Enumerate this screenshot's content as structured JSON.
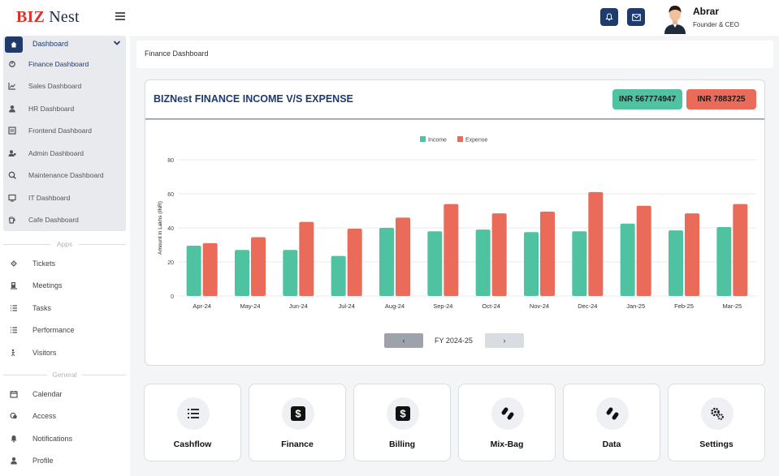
{
  "brand": {
    "part1": "BIZ",
    "part2": "Nest"
  },
  "user": {
    "name": "Abrar",
    "role": "Founder & CEO"
  },
  "sidebar": {
    "dashboard_label": "Dashboard",
    "dashboards": [
      {
        "label": "Finance Dashboard",
        "icon": "finance-icon"
      },
      {
        "label": "Sales Dashboard",
        "icon": "sales-icon"
      },
      {
        "label": "HR Dashboard",
        "icon": "hr-icon"
      },
      {
        "label": "Frontend Dashboard",
        "icon": "frontend-icon"
      },
      {
        "label": "Admin Dashboard",
        "icon": "admin-icon"
      },
      {
        "label": "Maintenance Dashboard",
        "icon": "maintenance-icon"
      },
      {
        "label": "IT Dashboard",
        "icon": "it-icon"
      },
      {
        "label": "Cafe Dashboard",
        "icon": "cafe-icon"
      }
    ],
    "apps_section": "Apps",
    "apps": [
      {
        "label": "Tickets",
        "icon": "ticket-icon"
      },
      {
        "label": "Meetings",
        "icon": "meeting-icon"
      },
      {
        "label": "Tasks",
        "icon": "tasks-icon"
      },
      {
        "label": "Performance",
        "icon": "performance-icon"
      },
      {
        "label": "Visitors",
        "icon": "visitors-icon"
      }
    ],
    "general_section": "General",
    "general": [
      {
        "label": "Calendar",
        "icon": "calendar-icon"
      },
      {
        "label": "Access",
        "icon": "access-icon"
      },
      {
        "label": "Notifications",
        "icon": "bell-icon"
      },
      {
        "label": "Profile",
        "icon": "profile-icon"
      }
    ]
  },
  "breadcrumb": "Finance Dashboard",
  "card": {
    "title": "BIZNest FINANCE INCOME V/S EXPENSE",
    "income_badge": "INR  567774947",
    "expense_badge": "INR  7883725",
    "prev_label": "‹",
    "next_label": "›",
    "period_label": "FY 2024-25"
  },
  "colors": {
    "income": "#4fc3a1",
    "expense": "#ea6b5a",
    "navy": "#1f3b6e"
  },
  "chart_data": {
    "type": "bar",
    "categories": [
      "Apr-24",
      "May-24",
      "Jun-24",
      "Jul-24",
      "Aug-24",
      "Sep-24",
      "Oct-24",
      "Nov-24",
      "Dec-24",
      "Jan-25",
      "Feb-25",
      "Mar-25"
    ],
    "series": [
      {
        "name": "Income",
        "values": [
          29.5,
          27,
          27,
          23.5,
          40,
          38,
          39,
          37.5,
          38,
          42.5,
          38.5,
          40.5
        ]
      },
      {
        "name": "Expense",
        "values": [
          31,
          34.5,
          43.5,
          39.5,
          46,
          54,
          48.5,
          49.5,
          61,
          53,
          48.5,
          54
        ]
      }
    ],
    "ylabel": "Amount in Lakhs (INR)",
    "yticks": [
      "0",
      "20",
      "40",
      "60",
      "80"
    ],
    "ylim": [
      0,
      80
    ],
    "grid": true,
    "legend": "top-center"
  },
  "tiles": [
    {
      "label": "Cashflow",
      "icon": "list-icon"
    },
    {
      "label": "Finance",
      "icon": "dollar-icon"
    },
    {
      "label": "Billing",
      "icon": "dollar-icon"
    },
    {
      "label": "Mix-Bag",
      "icon": "pills-icon"
    },
    {
      "label": "Data",
      "icon": "pills-icon"
    },
    {
      "label": "Settings",
      "icon": "gears-icon"
    }
  ]
}
